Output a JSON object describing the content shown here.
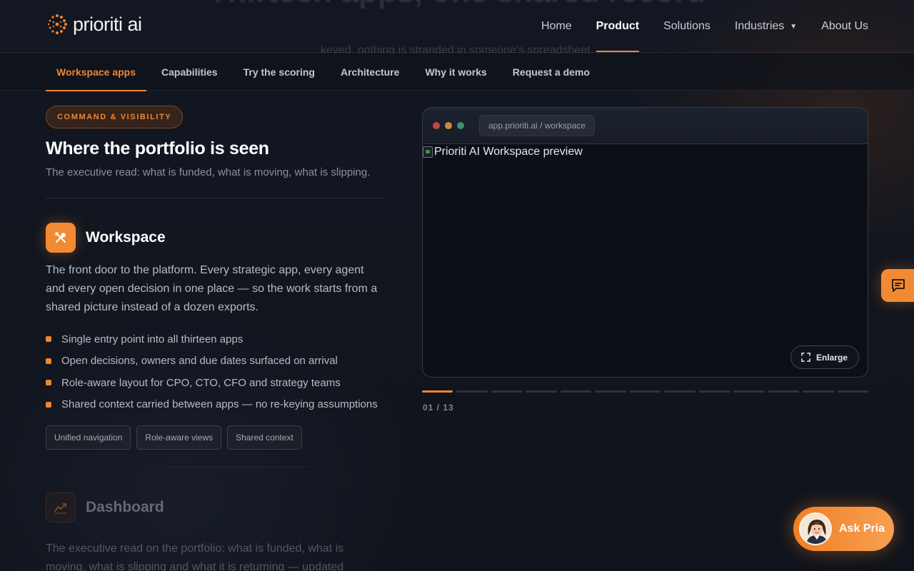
{
  "hero": {
    "ghost_title": "Thirteen apps, one shared record",
    "ghost_subtitle": "keyed, nothing is stranded in someone's spreadsheet."
  },
  "header": {
    "logo_text": "prioriti ai",
    "nav": [
      {
        "label": "Home",
        "active": false
      },
      {
        "label": "Product",
        "active": true
      },
      {
        "label": "Solutions",
        "active": false
      },
      {
        "label": "Industries",
        "active": false,
        "has_dropdown": true
      },
      {
        "label": "About Us",
        "active": false
      }
    ]
  },
  "subnav": {
    "items": [
      "Workspace apps",
      "Capabilities",
      "Try the scoring",
      "Architecture",
      "Why it works",
      "Request a demo"
    ],
    "active_index": 0
  },
  "section": {
    "badge": "COMMAND & VISIBILITY",
    "title": "Where the portfolio is seen",
    "subtitle": "The executive read: what is funded, what is moving, what is slipping."
  },
  "app": {
    "icon": "tools-icon",
    "title": "Workspace",
    "description": "The front door to the platform. Every strategic app, every agent and every open decision in one place — so the work starts from a shared picture instead of a dozen exports.",
    "bullets": [
      "Single entry point into all thirteen apps",
      "Open decisions, owners and due dates surfaced on arrival",
      "Role-aware layout for CPO, CTO, CFO and strategy teams",
      "Shared context carried between apps — no re-keying assumptions"
    ],
    "tags": [
      "Unified navigation",
      "Role-aware views",
      "Shared context"
    ]
  },
  "next_app": {
    "icon": "trend-chart-icon",
    "title": "Dashboard",
    "description": "The executive read on the portfolio: what is funded, what is moving, what is slipping and what it is returning — updated"
  },
  "preview": {
    "url": "app.prioriti.ai / workspace",
    "image_alt": "Prioriti AI Workspace preview",
    "enlarge_label": "Enlarge",
    "current": "01",
    "total": "13",
    "counter": "01 / 13",
    "segment_count": 13,
    "active_segment": 1
  },
  "colors": {
    "accent": "#f0862f",
    "background": "#10141d",
    "traffic_red": "#c4473f",
    "traffic_yellow": "#c98a3c",
    "traffic_green": "#3f8f6a"
  },
  "assistant": {
    "label": "Ask Pria",
    "chat_icon": "chat-bubble-icon"
  }
}
